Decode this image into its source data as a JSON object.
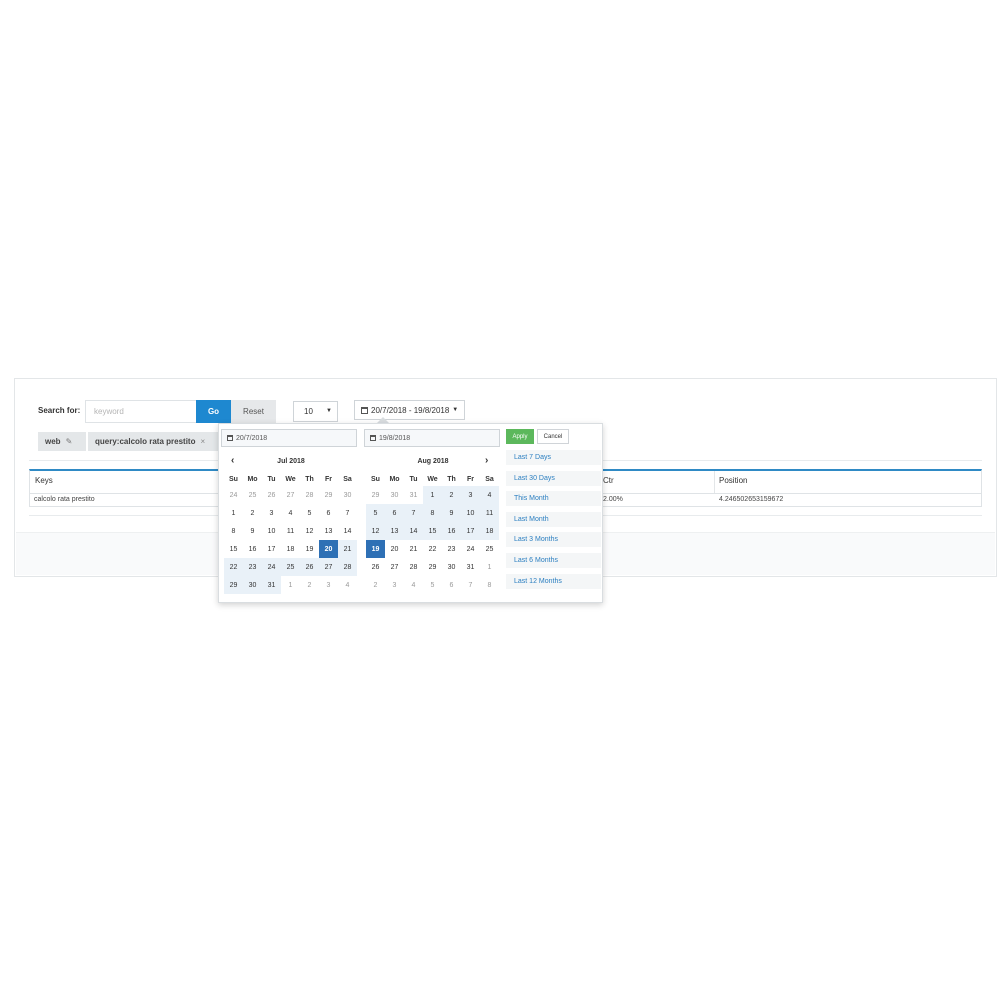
{
  "search": {
    "label": "Search for:",
    "placeholder": "keyword",
    "go_label": "Go",
    "reset_label": "Reset"
  },
  "per_page": {
    "value": "10"
  },
  "date_range": {
    "label": "20/7/2018 - 19/8/2018"
  },
  "chips": [
    {
      "label": "web"
    },
    {
      "label": "query:calcolo rata prestito"
    }
  ],
  "table": {
    "headers": {
      "keys": "Keys",
      "ctr": "Ctr",
      "position": "Position"
    },
    "rows": [
      {
        "keys": "calcolo rata prestito",
        "ctr": "2.00%",
        "position": "4.246502653159672"
      }
    ]
  },
  "picker": {
    "start_input": "20/7/2018",
    "end_input": "19/8/2018",
    "apply_label": "Apply",
    "cancel_label": "Cancel",
    "prev_symbol": "‹",
    "next_symbol": "›",
    "weekdays": [
      "Su",
      "Mo",
      "Tu",
      "We",
      "Th",
      "Fr",
      "Sa"
    ],
    "months": [
      {
        "title": "Jul 2018",
        "weeks": [
          [
            [
              "24",
              "off"
            ],
            [
              "25",
              "off"
            ],
            [
              "26",
              "off"
            ],
            [
              "27",
              "off"
            ],
            [
              "28",
              "off"
            ],
            [
              "29",
              "off"
            ],
            [
              "30",
              "off"
            ]
          ],
          [
            [
              "1",
              "on"
            ],
            [
              "2",
              "on"
            ],
            [
              "3",
              "on"
            ],
            [
              "4",
              "on"
            ],
            [
              "5",
              "on"
            ],
            [
              "6",
              "on"
            ],
            [
              "7",
              "on"
            ]
          ],
          [
            [
              "8",
              "on"
            ],
            [
              "9",
              "on"
            ],
            [
              "10",
              "on"
            ],
            [
              "11",
              "on"
            ],
            [
              "12",
              "on"
            ],
            [
              "13",
              "on"
            ],
            [
              "14",
              "on"
            ]
          ],
          [
            [
              "15",
              "on"
            ],
            [
              "16",
              "on"
            ],
            [
              "17",
              "on"
            ],
            [
              "18",
              "on"
            ],
            [
              "19",
              "on"
            ],
            [
              "20",
              "sel"
            ],
            [
              "21",
              "in"
            ]
          ],
          [
            [
              "22",
              "in"
            ],
            [
              "23",
              "in"
            ],
            [
              "24",
              "in"
            ],
            [
              "25",
              "in"
            ],
            [
              "26",
              "in"
            ],
            [
              "27",
              "in"
            ],
            [
              "28",
              "in"
            ]
          ],
          [
            [
              "29",
              "in"
            ],
            [
              "30",
              "in"
            ],
            [
              "31",
              "in"
            ],
            [
              "1",
              "off"
            ],
            [
              "2",
              "off"
            ],
            [
              "3",
              "off"
            ],
            [
              "4",
              "off"
            ]
          ]
        ]
      },
      {
        "title": "Aug 2018",
        "weeks": [
          [
            [
              "29",
              "off"
            ],
            [
              "30",
              "off"
            ],
            [
              "31",
              "off"
            ],
            [
              "1",
              "in"
            ],
            [
              "2",
              "in"
            ],
            [
              "3",
              "in"
            ],
            [
              "4",
              "in"
            ]
          ],
          [
            [
              "5",
              "in"
            ],
            [
              "6",
              "in"
            ],
            [
              "7",
              "in"
            ],
            [
              "8",
              "in"
            ],
            [
              "9",
              "in"
            ],
            [
              "10",
              "in"
            ],
            [
              "11",
              "in"
            ]
          ],
          [
            [
              "12",
              "in"
            ],
            [
              "13",
              "in"
            ],
            [
              "14",
              "in"
            ],
            [
              "15",
              "in"
            ],
            [
              "16",
              "in"
            ],
            [
              "17",
              "in"
            ],
            [
              "18",
              "in"
            ]
          ],
          [
            [
              "19",
              "sel"
            ],
            [
              "20",
              "on"
            ],
            [
              "21",
              "on"
            ],
            [
              "22",
              "on"
            ],
            [
              "23",
              "on"
            ],
            [
              "24",
              "on"
            ],
            [
              "25",
              "on"
            ]
          ],
          [
            [
              "26",
              "on"
            ],
            [
              "27",
              "on"
            ],
            [
              "28",
              "on"
            ],
            [
              "29",
              "on"
            ],
            [
              "30",
              "on"
            ],
            [
              "31",
              "on"
            ],
            [
              "1",
              "off"
            ]
          ],
          [
            [
              "2",
              "off"
            ],
            [
              "3",
              "off"
            ],
            [
              "4",
              "off"
            ],
            [
              "5",
              "off"
            ],
            [
              "6",
              "off"
            ],
            [
              "7",
              "off"
            ],
            [
              "8",
              "off"
            ]
          ]
        ]
      }
    ],
    "ranges": [
      "Last 7 Days",
      "Last 30 Days",
      "This Month",
      "Last Month",
      "Last 3 Months",
      "Last 6 Months",
      "Last 12 Months"
    ]
  },
  "colors": {
    "primary": "#1e88d0",
    "apply": "#5cb85c",
    "selected": "#2e70b5",
    "in_range": "#e9f1f8",
    "range_link": "#2a7ec0"
  }
}
